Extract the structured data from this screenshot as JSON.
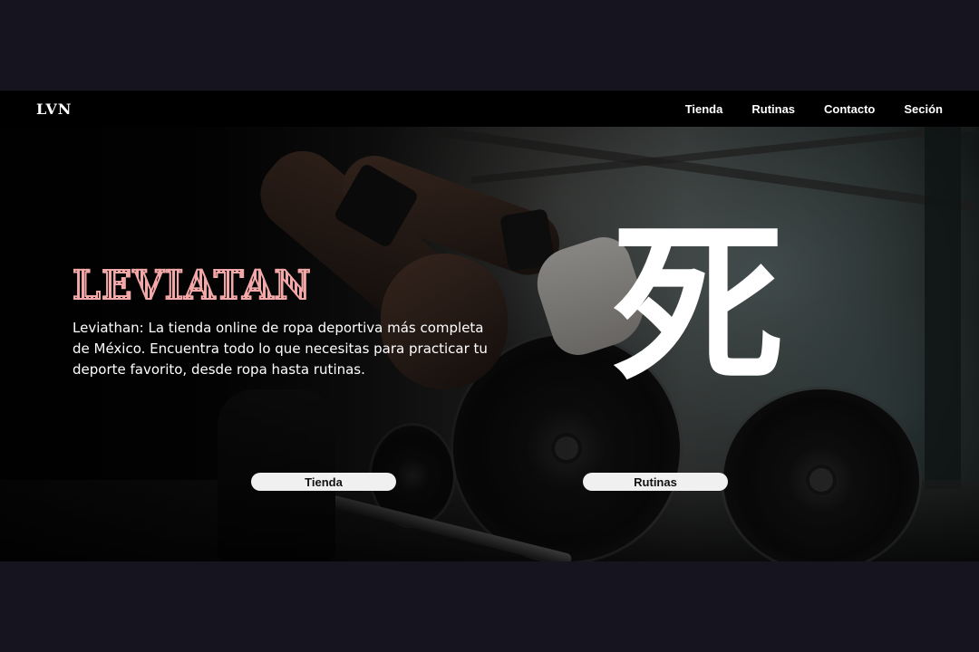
{
  "navbar": {
    "logo": "LVN",
    "links": [
      {
        "label": "Tienda"
      },
      {
        "label": "Rutinas"
      },
      {
        "label": "Contacto"
      },
      {
        "label": "Seción"
      }
    ]
  },
  "hero": {
    "title": "LEVIATAN",
    "description": "Leviathan: La tienda online de ropa deportiva más completa de México. Encuentra todo lo que necesitas para practicar tu deporte favorito, desde ropa hasta rutinas.",
    "kanji": "死",
    "buttons": [
      {
        "label": "Tienda"
      },
      {
        "label": "Rutinas"
      }
    ]
  },
  "colors": {
    "page_frame": "#15141f",
    "navbar_bg": "#000000",
    "title_accent": "#f4a7a7",
    "button_bg": "#f0f0f0"
  }
}
